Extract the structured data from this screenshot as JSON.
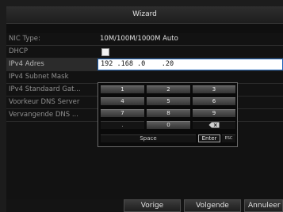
{
  "window": {
    "title": "Wizard"
  },
  "form": {
    "nic_type": {
      "label": "NIC Type:",
      "value": "10M/100M/1000M Auto"
    },
    "dhcp": {
      "label": "DHCP",
      "checked": false
    },
    "ipv4_address": {
      "label": "IPv4 Adres",
      "value": "192 .168 .0    .20"
    },
    "ipv4_subnet_mask": {
      "label": "IPv4 Subnet Mask"
    },
    "ipv4_default_gateway": {
      "label": "IPv4 Standaard Gat..."
    },
    "preferred_dns": {
      "label": "Voorkeur DNS Server"
    },
    "alternate_dns": {
      "label": "Vervangende DNS ..."
    }
  },
  "keypad": {
    "keys": {
      "k1": "1",
      "k2": "2",
      "k3": "3",
      "k4": "4",
      "k5": "5",
      "k6": "6",
      "k7": "7",
      "k8": "8",
      "k9": "9",
      "dot": ".",
      "k0": "0"
    },
    "space_label": "Space",
    "enter_label": "Enter",
    "esc_label": "ESC",
    "backspace_icon": "backspace-icon"
  },
  "buttons": {
    "previous": "Vorige",
    "next": "Volgende",
    "cancel": "Annuleer"
  }
}
